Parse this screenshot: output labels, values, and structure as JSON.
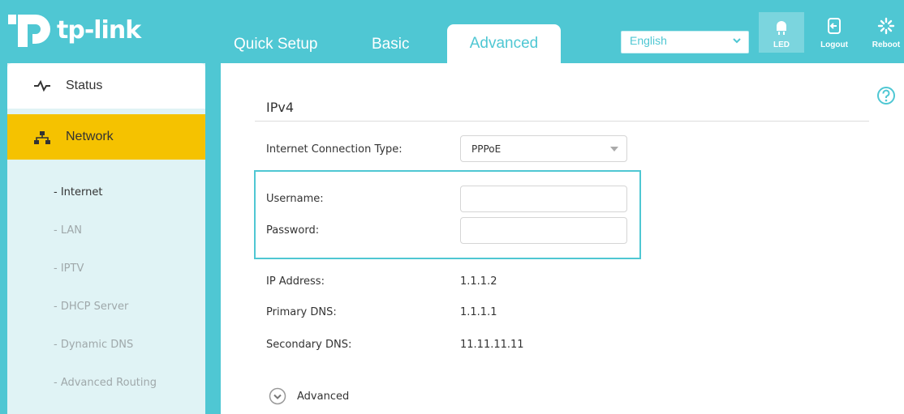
{
  "brand": {
    "name": "tp-link"
  },
  "nav": {
    "tabs": [
      {
        "label": "Quick Setup"
      },
      {
        "label": "Basic"
      },
      {
        "label": "Advanced",
        "active": true
      }
    ]
  },
  "header": {
    "language": {
      "selected": "English"
    },
    "buttons": {
      "led": "LED",
      "logout": "Logout",
      "reboot": "Reboot"
    }
  },
  "sidebar": {
    "status": "Status",
    "network": "Network",
    "sub_items": [
      {
        "label": "- Internet",
        "active": true
      },
      {
        "label": "- LAN"
      },
      {
        "label": "- IPTV"
      },
      {
        "label": "- DHCP Server"
      },
      {
        "label": "- Dynamic DNS"
      },
      {
        "label": "- Advanced Routing"
      }
    ]
  },
  "main": {
    "section_title": "IPv4",
    "connection_type": {
      "label": "Internet Connection Type:",
      "value": "PPPoE"
    },
    "username": {
      "label": "Username:",
      "value": ""
    },
    "password": {
      "label": "Password:",
      "value": ""
    },
    "ip_address": {
      "label": "IP Address:",
      "value": "1.1.1.2"
    },
    "primary_dns": {
      "label": "Primary DNS:",
      "value": "1.1.1.1"
    },
    "secondary_dns": {
      "label": "Secondary DNS:",
      "value": "11.11.11.11"
    },
    "advanced_toggle": "Advanced"
  },
  "colors": {
    "header_bg": "#4fc7d3",
    "active_nav": "#f5c200",
    "sidebar_bg": "#e0f3f5"
  }
}
